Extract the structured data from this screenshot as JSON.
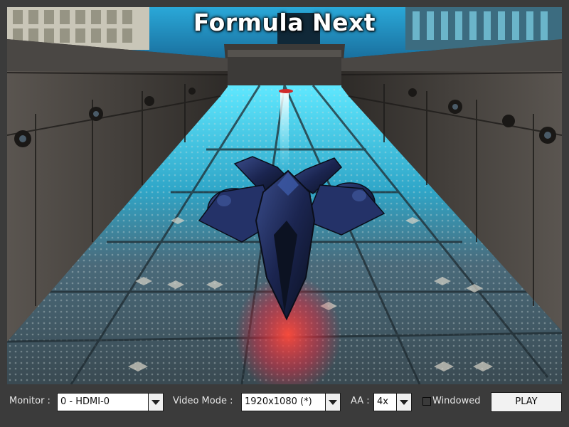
{
  "game": {
    "title": "Formula Next"
  },
  "settings": {
    "monitor_label": "Monitor :",
    "monitor_value": "0 - HDMI-0",
    "video_mode_label": "Video Mode :",
    "video_mode_value": "1920x1080 (*)",
    "aa_label": "AA :",
    "aa_value": "4x",
    "windowed_label": "Windowed",
    "windowed_checked": false,
    "play_label": "PLAY"
  },
  "icons": {
    "dropdown": "chevron-down-icon",
    "checkbox": "checkbox-icon"
  },
  "colors": {
    "background": "#3b3b3b",
    "track_glow": "#38d8f0",
    "engine_glow": "#ff3a2a",
    "ship_body": "#1c2a5a"
  }
}
